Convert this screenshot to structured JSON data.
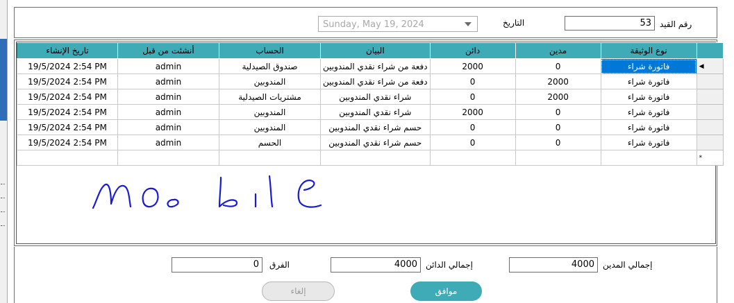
{
  "header": {
    "entry_no_label": "رقم القيد",
    "entry_no_value": "53",
    "date_label": "التاريخ",
    "date_value": "Sunday, May 19, 2024"
  },
  "grid": {
    "columns": [
      "نوع الوثيقة",
      "مدين",
      "دائن",
      "البيان",
      "الحساب",
      "أنشئت من قبل",
      "تاريخ الإنشاء"
    ],
    "rows": [
      [
        "فاتورة شراء",
        "0",
        "2000",
        "دفعة من شراء نقدي المندوبين",
        "صندوق الصيدلية",
        "admin",
        "19/5/2024 2:54 PM"
      ],
      [
        "فاتورة شراء",
        "2000",
        "0",
        "دفعة من شراء نقدي المندوبين",
        "المندوبين",
        "admin",
        "19/5/2024 2:54 PM"
      ],
      [
        "فاتورة شراء",
        "2000",
        "0",
        "شراء نقدي المندوبين",
        "مشتريات الصيدلية",
        "admin",
        "19/5/2024 2:54 PM"
      ],
      [
        "فاتورة شراء",
        "0",
        "2000",
        "شراء نقدي المندوبين",
        "المندوبين",
        "admin",
        "19/5/2024 2:54 PM"
      ],
      [
        "فاتورة شراء",
        "0",
        "0",
        "حسم شراء نقدي المندوبين",
        "المندوبين",
        "admin",
        "19/5/2024 2:54 PM"
      ],
      [
        "فاتورة شراء",
        "0",
        "0",
        "حسم شراء نقدي المندوبين",
        "الحسم",
        "admin",
        "19/5/2024 2:54 PM"
      ]
    ],
    "current_row_marker": "◀",
    "new_row_marker": "*"
  },
  "handwriting": "mobile",
  "totals": {
    "debit_label": "إجمالي المدين",
    "debit_value": "4000",
    "credit_label": "إجمالي الدائن",
    "credit_value": "4000",
    "diff_label": "الفرق",
    "diff_value": "0"
  },
  "buttons": {
    "ok": "موافق",
    "cancel": "إلغاء"
  },
  "colors": {
    "header_teal": "#3fabb7",
    "selection_blue": "#0078d7",
    "handwriting_blue": "#1a1ad6"
  }
}
